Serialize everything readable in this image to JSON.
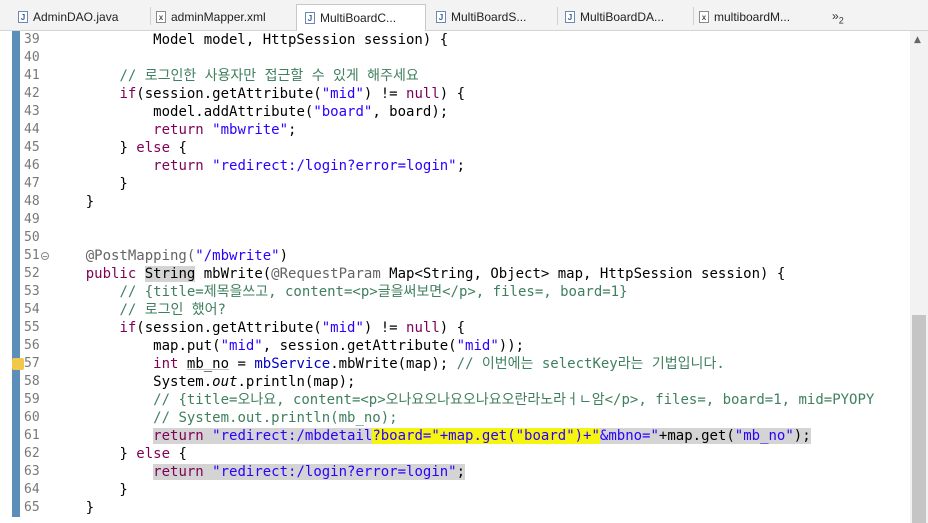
{
  "tabs": [
    {
      "label": "AdminDAO.java",
      "icon": "java-file-icon",
      "glyph": "J",
      "active": false
    },
    {
      "label": "adminMapper.xml",
      "icon": "xml-file-icon",
      "glyph": "x",
      "active": false
    },
    {
      "label": "MultiBoardC...",
      "icon": "java-file-icon",
      "glyph": "J",
      "active": true
    },
    {
      "label": "MultiBoardS...",
      "icon": "java-file-icon",
      "glyph": "J",
      "active": false
    },
    {
      "label": "MultiBoardDA...",
      "icon": "java-file-icon",
      "glyph": "J",
      "active": false
    },
    {
      "label": "multiboardM...",
      "icon": "xml-file-icon",
      "glyph": "x",
      "active": false
    }
  ],
  "overflow": {
    "glyph": "»",
    "count": "2"
  },
  "code": {
    "l39": {
      "num": "39",
      "text": "            Model model, HttpSession session) {"
    },
    "l40": {
      "num": "40"
    },
    "l41": {
      "num": "41",
      "indent": "        ",
      "comment": "// 로그인한 사용자만 접근할 수 있게 해주세요"
    },
    "l42": {
      "num": "42",
      "indent": "        ",
      "kw_if": "if",
      "a": "(session.getAttribute(",
      "s1": "\"mid\"",
      "b": ") != ",
      "kw_null": "null",
      "c": ") {"
    },
    "l43": {
      "num": "43",
      "indent": "            ",
      "a": "model.addAttribute(",
      "s1": "\"board\"",
      "b": ", board);"
    },
    "l44": {
      "num": "44",
      "indent": "            ",
      "kw": "return",
      "sp": " ",
      "s1": "\"mbwrite\"",
      "b": ";"
    },
    "l45": {
      "num": "45",
      "indent": "        ",
      "a": "} ",
      "kw": "else",
      "b": " {"
    },
    "l46": {
      "num": "46",
      "indent": "            ",
      "kw": "return",
      "sp": " ",
      "s1": "\"redirect:/login?error=login\"",
      "b": ";"
    },
    "l47": {
      "num": "47",
      "text": "        }"
    },
    "l48": {
      "num": "48",
      "text": "    }"
    },
    "l49": {
      "num": "49"
    },
    "l50": {
      "num": "50"
    },
    "l51": {
      "num": "51",
      "indent": "    ",
      "ann": "@PostMapping(",
      "s1": "\"/mbwrite\"",
      "b": ")"
    },
    "l52": {
      "num": "52",
      "indent": "    ",
      "kw": "public",
      "sp": " ",
      "sel": "String",
      "a": " mbWrite(",
      "ann": "@RequestParam",
      "b": " Map<String, Object> map, HttpSession session) {"
    },
    "l53": {
      "num": "53",
      "indent": "        ",
      "comment": "// {title=제목을쓰고, content=<p>글을써보면</p>, files=, board=1}"
    },
    "l54": {
      "num": "54",
      "indent": "        ",
      "comment": "// 로그인 했어?"
    },
    "l55": {
      "num": "55",
      "indent": "        ",
      "kw_if": "if",
      "a": "(session.getAttribute(",
      "s1": "\"mid\"",
      "b": ") != ",
      "kw_null": "null",
      "c": ") {"
    },
    "l56": {
      "num": "56",
      "indent": "            ",
      "a": "map.put(",
      "s1": "\"mid\"",
      "b": ", session.getAttribute(",
      "s2": "\"mid\"",
      "c": "));"
    },
    "l57": {
      "num": "57",
      "indent": "            ",
      "kw": "int",
      "sp": " ",
      "var": "mb_no",
      "a": " = ",
      "fld": "mbService",
      "b": ".mbWrite(map); ",
      "comment": "// 이번에는 selectKey라는 기법입니다."
    },
    "l58": {
      "num": "58",
      "indent": "            ",
      "a": "System.",
      "ital": "out",
      "b": ".println(map);"
    },
    "l59": {
      "num": "59",
      "indent": "            ",
      "comment": "// {title=오나요, content=<p>오나요오나요오나요오란라노라ㅓㄴ암</p>, files=, board=1, mid=PYOPY"
    },
    "l60": {
      "num": "60",
      "indent": "            ",
      "comment": "// System.out.println(mb_no);"
    },
    "l61": {
      "num": "61",
      "indent": "            ",
      "kw": "return",
      "sp": " ",
      "s1": "\"redirect:/mbdetail",
      "hl": "?board=\"+map.get(\"board\")+\"",
      "s2": "&mbno=\"",
      "a": "+map.get(",
      "s3": "\"mb_no\"",
      "b": ");"
    },
    "l62": {
      "num": "62",
      "indent": "        ",
      "a": "} ",
      "kw": "else",
      "b": " {"
    },
    "l63": {
      "num": "63",
      "indent": "            ",
      "kw": "return",
      "sp": " ",
      "s1": "\"redirect:/login?error=login\"",
      "b": ";"
    },
    "l64": {
      "num": "64",
      "text": "        }"
    },
    "l65": {
      "num": "65",
      "text": "    }"
    }
  }
}
